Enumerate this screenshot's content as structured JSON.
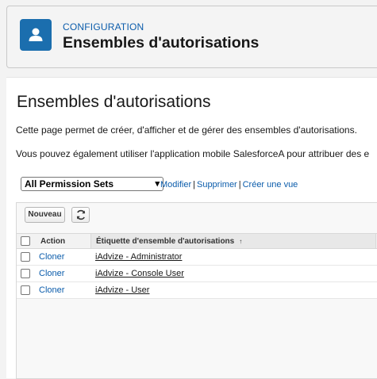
{
  "header": {
    "subtitle": "CONFIGURATION",
    "title": "Ensembles d'autorisations",
    "icon": "user-icon",
    "icon_color": "#1b6eae"
  },
  "main": {
    "title": "Ensembles d'autorisations",
    "description_1": "Cette page permet de créer, d'afficher et de gérer des ensembles d'autorisations.",
    "description_2": "Vous pouvez également utiliser l'application mobile SalesforceA pour attribuer des e"
  },
  "view": {
    "selected": "All Permission Sets",
    "links": [
      "Modifier",
      "Supprimer",
      "Créer une vue"
    ]
  },
  "list": {
    "new_button": "Nouveau",
    "refresh_icon": "refresh-icon",
    "columns": {
      "action": "Action",
      "label": "Étiquette d'ensemble d'autorisations",
      "sort": "↑"
    },
    "rows": [
      {
        "action": "Cloner",
        "label": "iAdvize - Administrator"
      },
      {
        "action": "Cloner",
        "label": "iAdvize - Console User"
      },
      {
        "action": "Cloner",
        "label": "iAdvize - User"
      }
    ]
  },
  "colors": {
    "link": "#0b5cab",
    "accent": "#1b6eae"
  }
}
